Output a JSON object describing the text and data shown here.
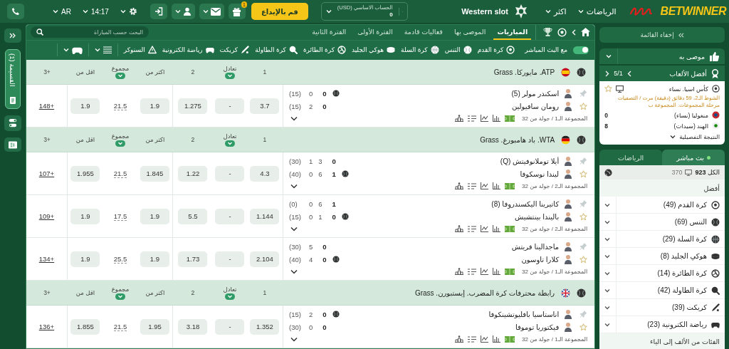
{
  "topbar": {
    "brand": "BETWINNER",
    "nav": [
      {
        "label": "الرياضات"
      },
      {
        "label": "اكثر"
      }
    ],
    "promo": "Western slot",
    "account": {
      "label": "الحساب الاساسي (USD)",
      "balance": "0"
    },
    "deposit": "قم بالإيداع",
    "gift_count": "1",
    "time": "14:17",
    "language": "AR"
  },
  "left_rail": {
    "bet_slip": "القسيمة (1)"
  },
  "tabs": [
    {
      "label": "المباريات",
      "selected": true
    },
    {
      "label": "الموصى بها",
      "selected": false
    },
    {
      "label": "فعاليات قادمة",
      "selected": false
    },
    {
      "label": "الفترة الأولى",
      "selected": false
    },
    {
      "label": "الفترة الثانية",
      "selected": false
    }
  ],
  "search": {
    "placeholder": "البحث حسب المباراة"
  },
  "live_toggle": {
    "label": "مع البث المباشر",
    "on": true
  },
  "sport_filters": [
    {
      "label": "كرة القدم",
      "kind": "soccer"
    },
    {
      "label": "التنس",
      "kind": "tennis"
    },
    {
      "label": "كرة السلة",
      "kind": "basketball"
    },
    {
      "label": "هوكي الجليد",
      "kind": "hockey"
    },
    {
      "label": "كرة الطائرة",
      "kind": "volleyball"
    },
    {
      "label": "كرة الطاولة",
      "kind": "tabletennis"
    },
    {
      "label": "كريكت",
      "kind": "cricket"
    },
    {
      "label": "رياضة الكترونية",
      "kind": "esports"
    },
    {
      "label": "السنوكر",
      "kind": "snooker"
    }
  ],
  "leagues": [
    {
      "name": "ATP. مايوركا. Grass",
      "kind": "spain",
      "columns": [
        {
          "label": "1",
          "dropdown": false
        },
        {
          "label": "تعادل",
          "dropdown": true
        },
        {
          "label": "2",
          "dropdown": false
        },
        {
          "label": "اكثر من",
          "dropdown": false
        },
        {
          "label": "مجموع",
          "dropdown": true
        },
        {
          "label": "اقل من",
          "dropdown": false
        },
        {
          "label": "3+",
          "dropdown": false
        }
      ],
      "matches": [
        {
          "players": [
            {
              "name": "اسكندر مولر (5)",
              "serving": true,
              "sets": "0",
              "games": [
                "0"
              ],
              "points": "(15)"
            },
            {
              "name": "رومان سافيولين",
              "serving": false,
              "sets": "0",
              "games": [
                "2"
              ],
              "points": "(15)"
            }
          ],
          "group": "المجموعة الـ1 / جولة من 32",
          "odds": [
            "3.7",
            "-",
            "1.275",
            "1.9",
            "21.5",
            "1.9",
            "148+"
          ]
        }
      ]
    },
    {
      "name": "WTA. باد هامبورغ. Grass",
      "kind": "germany",
      "columns": [
        {
          "label": "1",
          "dropdown": false
        },
        {
          "label": "تعادل",
          "dropdown": true
        },
        {
          "label": "2",
          "dropdown": false
        },
        {
          "label": "اكثر من",
          "dropdown": false
        },
        {
          "label": "مجموع",
          "dropdown": true
        },
        {
          "label": "اقل من",
          "dropdown": false
        },
        {
          "label": "3+",
          "dropdown": false
        }
      ],
      "matches": [
        {
          "players": [
            {
              "name": "أيلا توملانوفيتش (Q)",
              "serving": false,
              "sets": "0",
              "games": [
                "3",
                "1"
              ],
              "points": "(30)"
            },
            {
              "name": "ليندا نوسكوفا",
              "serving": true,
              "sets": "1",
              "games": [
                "6",
                "0"
              ],
              "points": "(40)"
            }
          ],
          "group": "المجموعة الـ2 / جولة من 32",
          "odds": [
            "4.3",
            "-",
            "1.22",
            "1.845",
            "21.5",
            "1.955",
            "107+"
          ]
        },
        {
          "players": [
            {
              "name": "كاتيرينا اليكسندروفا (8)",
              "serving": false,
              "sets": "1",
              "games": [
                "6",
                "0"
              ],
              "points": "(0)"
            },
            {
              "name": "باليندا بينتشيش",
              "serving": true,
              "sets": "0",
              "games": [
                "1",
                "0"
              ],
              "points": "(15)"
            }
          ],
          "group": "المجموعة الـ2 / جولة من 32",
          "odds": [
            "1.144",
            "-",
            "5.5",
            "1.9",
            "17.5",
            "1.9",
            "109+"
          ]
        },
        {
          "players": [
            {
              "name": "ماجدالينا فريتش",
              "serving": false,
              "sets": "0",
              "games": [
                "5"
              ],
              "points": "(30)"
            },
            {
              "name": "كلارا تاوسون",
              "serving": true,
              "sets": "0",
              "games": [
                "4"
              ],
              "points": "(40)"
            }
          ],
          "group": "المجموعة الـ1 / جولة من 32",
          "odds": [
            "2.104",
            "-",
            "1.73",
            "1.9",
            "25.5",
            "1.9",
            "134+"
          ]
        }
      ]
    },
    {
      "name": "رابطة محترفات كرة المضرب. إيستبورن. Grass",
      "kind": "uk",
      "columns": [
        {
          "label": "1",
          "dropdown": false
        },
        {
          "label": "تعادل",
          "dropdown": true
        },
        {
          "label": "2",
          "dropdown": false
        },
        {
          "label": "اكثر من",
          "dropdown": false
        },
        {
          "label": "مجموع",
          "dropdown": true
        },
        {
          "label": "اقل من",
          "dropdown": false
        },
        {
          "label": "3+",
          "dropdown": false
        }
      ],
      "matches": [
        {
          "players": [
            {
              "name": "اناستاسيا بافليوتشينكوفا",
              "serving": true,
              "sets": "0",
              "games": [
                "2"
              ],
              "points": "(15)"
            },
            {
              "name": "فيكتوريا توموفا",
              "serving": false,
              "sets": "0",
              "games": [
                "0"
              ],
              "points": "(30)"
            }
          ],
          "group": "المجموعة الـ1 / جولة من 32",
          "odds": [
            "1.352",
            "-",
            "3.18",
            "1.95",
            "21.5",
            "1.855",
            "136+"
          ]
        }
      ]
    }
  ],
  "sidebar": {
    "hide_menu": "إخفاء القائمة",
    "recommended": "موصى به",
    "top_games": {
      "title": "أفضل الألعاب",
      "pager": "5/1"
    },
    "featured": {
      "league": "كأس اسيا. نساء",
      "status": "الشوط الـ2، 59 دقائق (دقيقة) مرت / التصفيات مرحلة المجموعات. المجموعة ب",
      "teams": [
        {
          "name": "منغوليا (نساء)",
          "score": "0"
        },
        {
          "name": "الهند (سيدات)",
          "score": "8"
        }
      ],
      "details": "النتيجة التفصيلية"
    },
    "live_tabs": [
      {
        "label": "بث مباشر",
        "selected": true
      },
      {
        "label": "الرياضات",
        "selected": false
      }
    ],
    "totals": {
      "all": "الكل **923**",
      "streams": "370"
    },
    "section": "أفضل",
    "sports": [
      {
        "label": "كرة القدم (49)",
        "kind": "soccer"
      },
      {
        "label": "التنس (69)",
        "kind": "tennis"
      },
      {
        "label": "كرة السلة (29)",
        "kind": "basketball"
      },
      {
        "label": "هوكي الجليد (8)",
        "kind": "hockey"
      },
      {
        "label": "كرة الطائرة (14)",
        "kind": "volleyball"
      },
      {
        "label": "كرة الطاولة (42)",
        "kind": "tabletennis"
      },
      {
        "label": "كريكت (39)",
        "kind": "cricket"
      },
      {
        "label": "رياضة الكترونية (23)",
        "kind": "esports"
      }
    ],
    "footer": "الفئات من الألف إلى الياء"
  }
}
